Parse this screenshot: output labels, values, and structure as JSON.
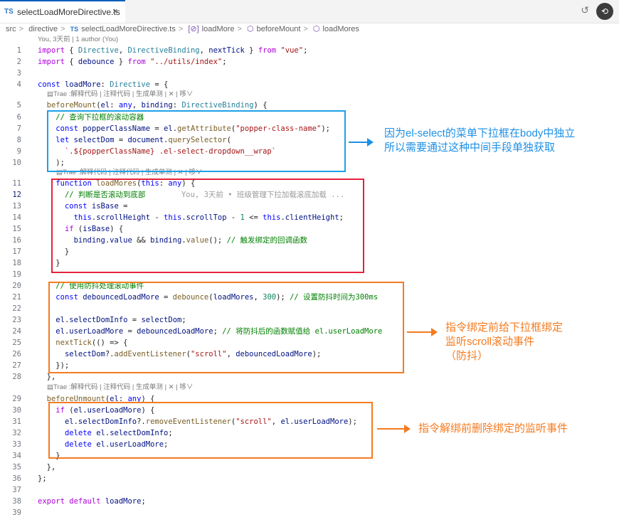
{
  "tab": {
    "lang": "TS",
    "filename": "selectLoadMoreDirective.ts",
    "close": "×"
  },
  "toolbar": {
    "history_icon": "↺",
    "avatar_label": "⟲"
  },
  "breadcrumb": {
    "items": [
      "src",
      "directive",
      "selectLoadMoreDirective.ts",
      "loadMore",
      "beforeMount",
      "loadMores"
    ],
    "sep": ">",
    "ts": "TS",
    "func_icon": "[⊘]",
    "cube_icon": "⬡"
  },
  "blame_header": "You, 3天前 | 1 author (You)",
  "codelens": "▤Trae :解释代码 | 注释代码 | 生成单测 | ✕ | 哆∨",
  "inline_blame_12": "You, 3天前 • 班级管理下拉加载滚底加载 ...",
  "active_line": 12,
  "lines": [
    {
      "n": "1",
      "t": "import { Directive, DirectiveBinding, nextTick } from \"vue\";"
    },
    {
      "n": "2",
      "t": "import { debounce } from \"../utils/index\";"
    },
    {
      "n": "3",
      "t": ""
    },
    {
      "n": "4",
      "t": "const loadMore: Directive = {"
    },
    {
      "n": "5",
      "t": "  beforeMount(el: any, binding: DirectiveBinding) {"
    },
    {
      "n": "6",
      "t": "    // 查询下拉框的滚动容器"
    },
    {
      "n": "7",
      "t": "    const popperClassName = el.getAttribute(\"popper-class-name\");"
    },
    {
      "n": "8",
      "t": "    let selectDom = document.querySelector("
    },
    {
      "n": "9",
      "t": "      `.${popperClassName} .el-select-dropdown__wrap`"
    },
    {
      "n": "10",
      "t": "    );"
    },
    {
      "n": "11",
      "t": "    function loadMores(this: any) {"
    },
    {
      "n": "12",
      "t": "      // 判断是否滚动到底部"
    },
    {
      "n": "13",
      "t": "      const isBase ="
    },
    {
      "n": "14",
      "t": "        this.scrollHeight - this.scrollTop - 1 <= this.clientHeight;"
    },
    {
      "n": "15",
      "t": "      if (isBase) {"
    },
    {
      "n": "16",
      "t": "        binding.value && binding.value(); // 触发绑定的回调函数"
    },
    {
      "n": "17",
      "t": "      }"
    },
    {
      "n": "18",
      "t": "    }"
    },
    {
      "n": "19",
      "t": ""
    },
    {
      "n": "20",
      "t": "    // 使用防抖处理滚动事件"
    },
    {
      "n": "21",
      "t": "    const debouncedLoadMore = debounce(loadMores, 300); // 设置防抖时间为300ms"
    },
    {
      "n": "22",
      "t": ""
    },
    {
      "n": "23",
      "t": "    el.selectDomInfo = selectDom;"
    },
    {
      "n": "24",
      "t": "    el.userLoadMore = debouncedLoadMore; // 将防抖后的函数赋值给 el.userLoadMore"
    },
    {
      "n": "25",
      "t": "    nextTick(() => {"
    },
    {
      "n": "26",
      "t": "      selectDom?.addEventListener(\"scroll\", debouncedLoadMore);"
    },
    {
      "n": "27",
      "t": "    });"
    },
    {
      "n": "28",
      "t": "  },"
    },
    {
      "n": "29",
      "t": "  beforeUnmount(el: any) {"
    },
    {
      "n": "30",
      "t": "    if (el.userLoadMore) {"
    },
    {
      "n": "31",
      "t": "      el.selectDomInfo?.removeEventListener(\"scroll\", el.userLoadMore);"
    },
    {
      "n": "32",
      "t": "      delete el.selectDomInfo;"
    },
    {
      "n": "33",
      "t": "      delete el.userLoadMore;"
    },
    {
      "n": "34",
      "t": "    }"
    },
    {
      "n": "35",
      "t": "  },"
    },
    {
      "n": "36",
      "t": "};"
    },
    {
      "n": "37",
      "t": ""
    },
    {
      "n": "38",
      "t": "export default loadMore;"
    },
    {
      "n": "39",
      "t": ""
    }
  ],
  "annotations": {
    "blue": "因为el-select的菜单下拉框在body中独立\n所以需要通过这种中间手段单独获取",
    "orange1": "指令绑定前给下拉框绑定\n监听scroll滚动事件\n（防抖）",
    "orange2": "指令解绑前删除绑定的监听事件"
  },
  "colors": {
    "blue_box": "#1ea0e8",
    "red_box": "#e5213b",
    "orange_box": "#f47b20",
    "keyword": "#0000ff",
    "comment": "#008000",
    "string": "#a31515"
  }
}
